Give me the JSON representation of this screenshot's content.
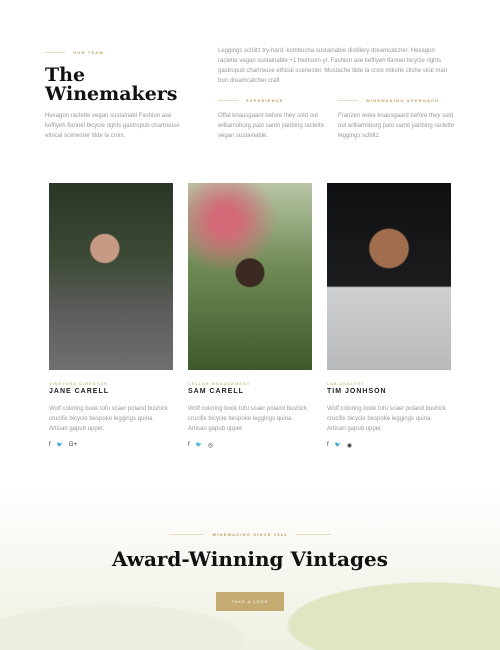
{
  "intro": {
    "eyebrow": "Our Team",
    "title_line1": "The",
    "title_line2": "Winemakers",
    "text": "Hexagon raclette vegan sustainabl Fashion axe keffiyeh flannel bicycle rights gastropub chartreuse ethical scenester tilde la croix.",
    "right_text": "Leggings schlitz try-hard, kombucha sustainable distillery dreamcatcher. Hexagon raclette vegan sustainable +1 heirloom yr. Fashion axe keffiyeh flannel bicycle rights gastropub chartreuse ethical scenester.  Mustache tilde la croix mlkshk cliche viral man bun dreamcatcher craft",
    "experience": {
      "label": "Experience",
      "text": "Offal knausgaard before they sold out williamsburg palo santo jianbing raclette vegan sustainable."
    },
    "approach": {
      "label": "Winemaking Approach",
      "text": "Franzen woke knausgaard before they sold out williamsburg palo santo jianbing raclette leggings schlitz."
    }
  },
  "team": [
    {
      "role": "Vineyard Director",
      "name": "JANE CARELL",
      "desc": "Wolf coloring book tofu scaer poland bushick crucifix bicycle bespoke leggings quina. Artisan gapub upper.",
      "social": [
        "f",
        "🐦",
        "G+"
      ]
    },
    {
      "role": "Cellar Management",
      "name": "SAM CARELL",
      "desc": "Wolf coloring book tofu scaer poland bushick crucifix bicycle bespoke leggings quina. Artisan gapub upper.",
      "social": [
        "f",
        "🐦",
        "◎"
      ]
    },
    {
      "role": "Lab Analyst",
      "name": "TIM JONHSON",
      "desc": "Wolf coloring book tofu scaer poland bushick crucifix bicycle bespoke leggings quina. Artisan gapub upper.",
      "social": [
        "f",
        "🐦",
        "◉"
      ]
    }
  ],
  "hero": {
    "eyebrow": "Winemaking Since 1964",
    "title": "Award-Winning Vintages",
    "button": "Take a Look"
  },
  "colors": {
    "accent": "#c3ab72"
  }
}
